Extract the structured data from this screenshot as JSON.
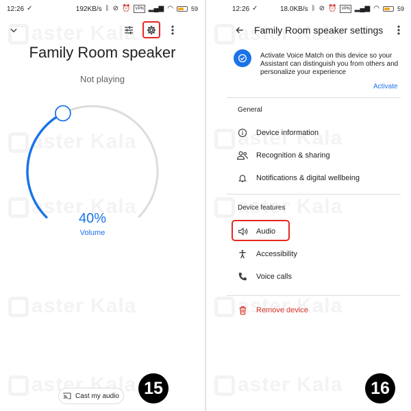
{
  "left": {
    "status": {
      "time": "12:26",
      "net_speed": "192KB/s",
      "battery": "59"
    },
    "toolbar": {
      "collapse_icon": "chevron-down-icon",
      "equalizer_icon": "equalizer-icon",
      "settings_icon": "gear-icon",
      "more_icon": "more-vert-icon"
    },
    "title": "Family Room speaker",
    "subtitle": "Not playing",
    "volume": {
      "value": 0.4,
      "percent_label": "40%",
      "label": "Volume"
    },
    "cast_button": "Cast my audio",
    "step": "15"
  },
  "right": {
    "status": {
      "time": "12:26",
      "net_speed": "18.0KB/s",
      "battery": "59"
    },
    "header": {
      "title": "Family Room speaker settings",
      "back_icon": "arrow-back-icon",
      "more_icon": "more-vert-icon"
    },
    "voice_match": {
      "text": "Activate Voice Match on this device so your Assistant can distinguish you from others and personalize your experience",
      "action": "Activate"
    },
    "general": {
      "title": "General",
      "items": [
        {
          "label": "Device information",
          "icon": "info-icon"
        },
        {
          "label": "Recognition & sharing",
          "icon": "people-icon"
        },
        {
          "label": "Notifications & digital wellbeing",
          "icon": "bell-icon"
        }
      ]
    },
    "device_features": {
      "title": "Device features",
      "items": [
        {
          "label": "Audio",
          "icon": "speaker-icon"
        },
        {
          "label": "Accessibility",
          "icon": "accessibility-icon"
        },
        {
          "label": "Voice calls",
          "icon": "phone-icon"
        }
      ]
    },
    "remove": {
      "label": "Remove device",
      "icon": "trash-icon"
    },
    "step": "16"
  },
  "colors": {
    "accent": "#1a73e8",
    "highlight": "#e52620",
    "danger": "#d93025"
  }
}
